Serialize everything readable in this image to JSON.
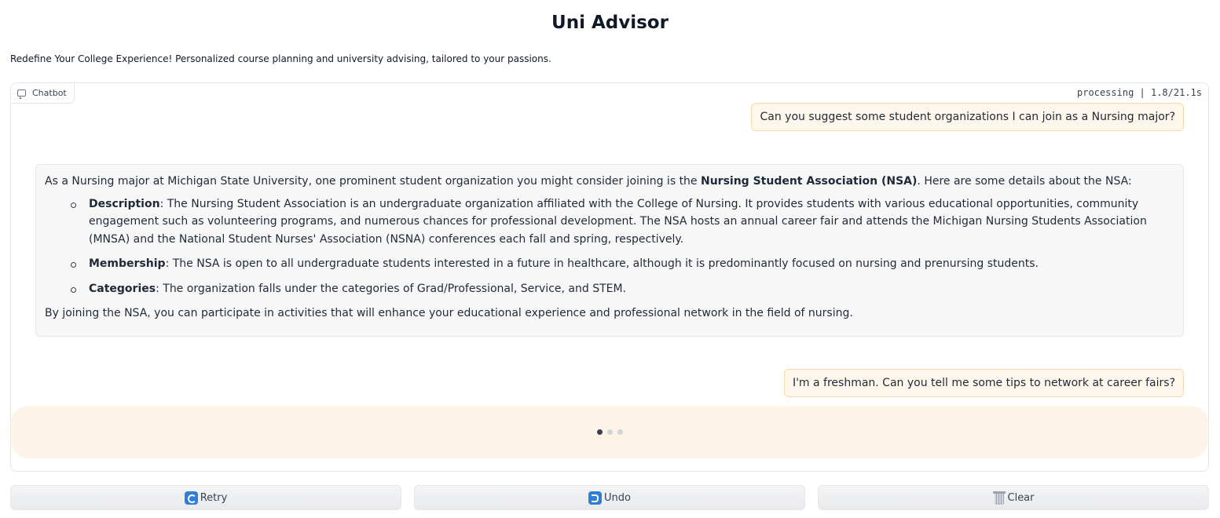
{
  "app": {
    "title": "Uni Advisor",
    "subtitle": "Redefine Your College Experience! Personalized course planning and university advising, tailored to your passions."
  },
  "chatbot": {
    "label": "Chatbot",
    "label_icon": "chat-bubble-icon",
    "status": "processing | 1.8/21.1s",
    "messages": [
      {
        "role": "user",
        "text": "Can you suggest some student organizations I can join as a Nursing major?"
      },
      {
        "role": "bot",
        "intro_pre": "As a Nursing major at Michigan State University, one prominent student organization you might consider joining is the ",
        "intro_bold": "Nursing Student Association (NSA)",
        "intro_post": ". Here are some details about the NSA:",
        "bullets": [
          {
            "term": "Description",
            "text": ": The Nursing Student Association is an undergraduate organization affiliated with the College of Nursing. It provides students with various educational opportunities, community engagement such as volunteering programs, and numerous chances for professional development. The NSA hosts an annual career fair and attends the Michigan Nursing Students Association (MNSA) and the National Student Nurses' Association (NSNA) conferences each fall and spring, respectively."
          },
          {
            "term": "Membership",
            "text": ": The NSA is open to all undergraduate students interested in a future in healthcare, although it is predominantly focused on nursing and prenursing students."
          },
          {
            "term": "Categories",
            "text": ": The organization falls under the categories of Grad/Professional, Service, and STEM."
          }
        ],
        "closing": "By joining the NSA, you can participate in activities that will enhance your educational experience and professional network in the field of nursing."
      },
      {
        "role": "user",
        "text": "I'm a freshman. Can you tell me some tips to network at career fairs?"
      }
    ],
    "pending_indicator": "loading-dots"
  },
  "buttons": {
    "retry": {
      "label": "Retry",
      "icon": "retry-icon"
    },
    "undo": {
      "label": "Undo",
      "icon": "undo-icon"
    },
    "clear": {
      "label": "Clear",
      "icon": "trash-icon"
    }
  },
  "colors": {
    "user_bubble_bg": "#fff7ec",
    "user_bubble_border": "#fcd9a8",
    "bot_bubble_bg": "#f7f7f8",
    "pending_bg": "#fdf3e6",
    "icon_blue": "#2f7fd6"
  }
}
